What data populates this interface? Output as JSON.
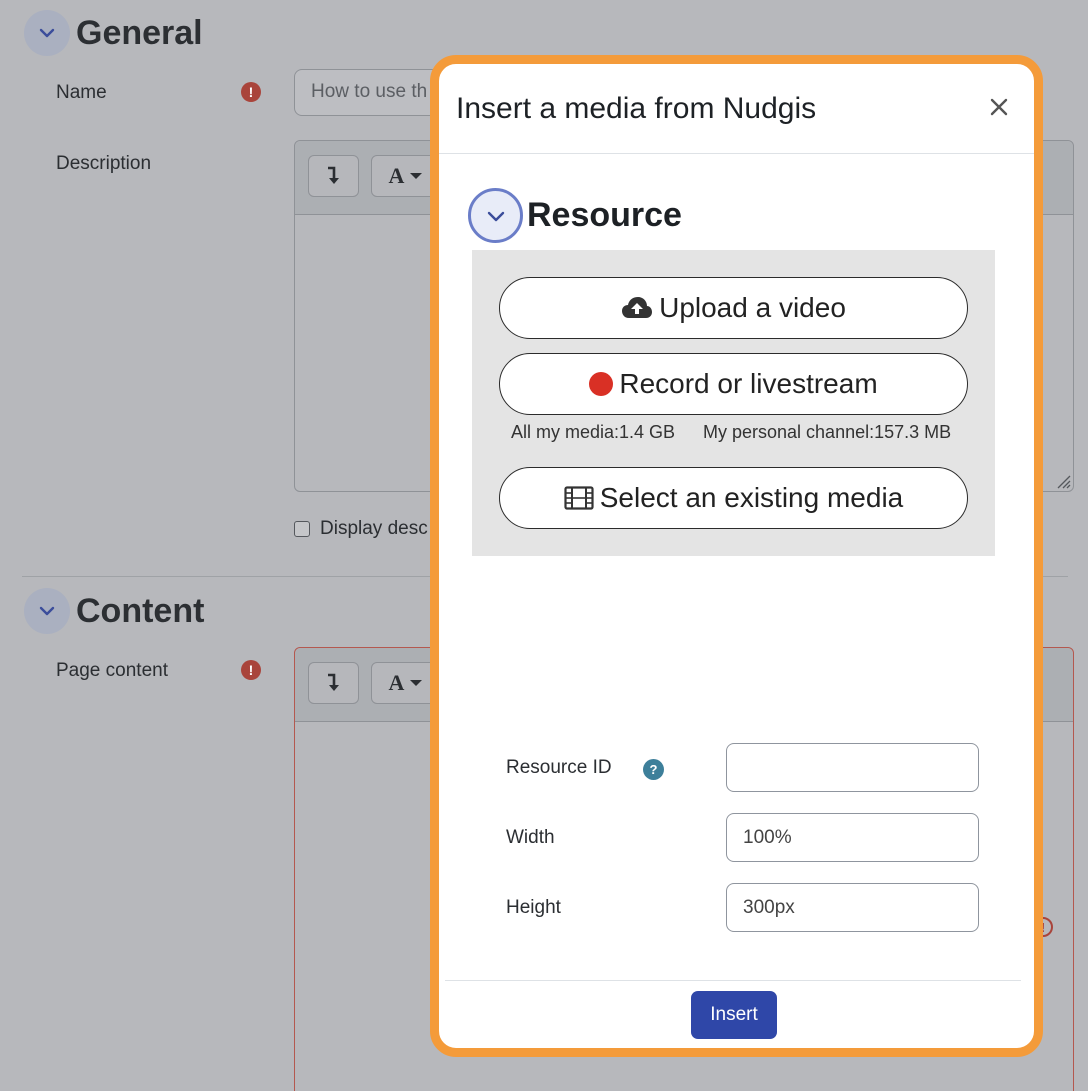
{
  "background_form": {
    "general": {
      "title": "General"
    },
    "name": {
      "label": "Name",
      "placeholder": "How to use th"
    },
    "description": {
      "label": "Description"
    },
    "display_description": {
      "label": "Display desc"
    },
    "content": {
      "title": "Content"
    },
    "page_content": {
      "label": "Page content"
    },
    "toolbar": {
      "text_style_label": "A"
    },
    "required_icon": "!"
  },
  "modal": {
    "title": "Insert a media from Nudgis",
    "close_icon": "close-icon",
    "resource": {
      "title": "Resource",
      "upload_label": "Upload a video",
      "record_label": "Record or livestream",
      "all_media_quota": "All my media:1.4 GB",
      "personal_channel_quota": "My personal channel:157.3 MB",
      "select_label": "Select an existing media"
    },
    "fields": {
      "resource_id": {
        "label": "Resource ID",
        "value": "",
        "help_icon": "?"
      },
      "width": {
        "label": "Width",
        "value": "100%"
      },
      "height": {
        "label": "Height",
        "value": "300px"
      }
    },
    "insert_label": "Insert"
  },
  "colors": {
    "modal_border": "#f49b3a",
    "primary_button": "#2f47a8",
    "record_dot": "#d93025",
    "required_icon": "#a9443b",
    "help_icon": "#3d7f9a"
  }
}
